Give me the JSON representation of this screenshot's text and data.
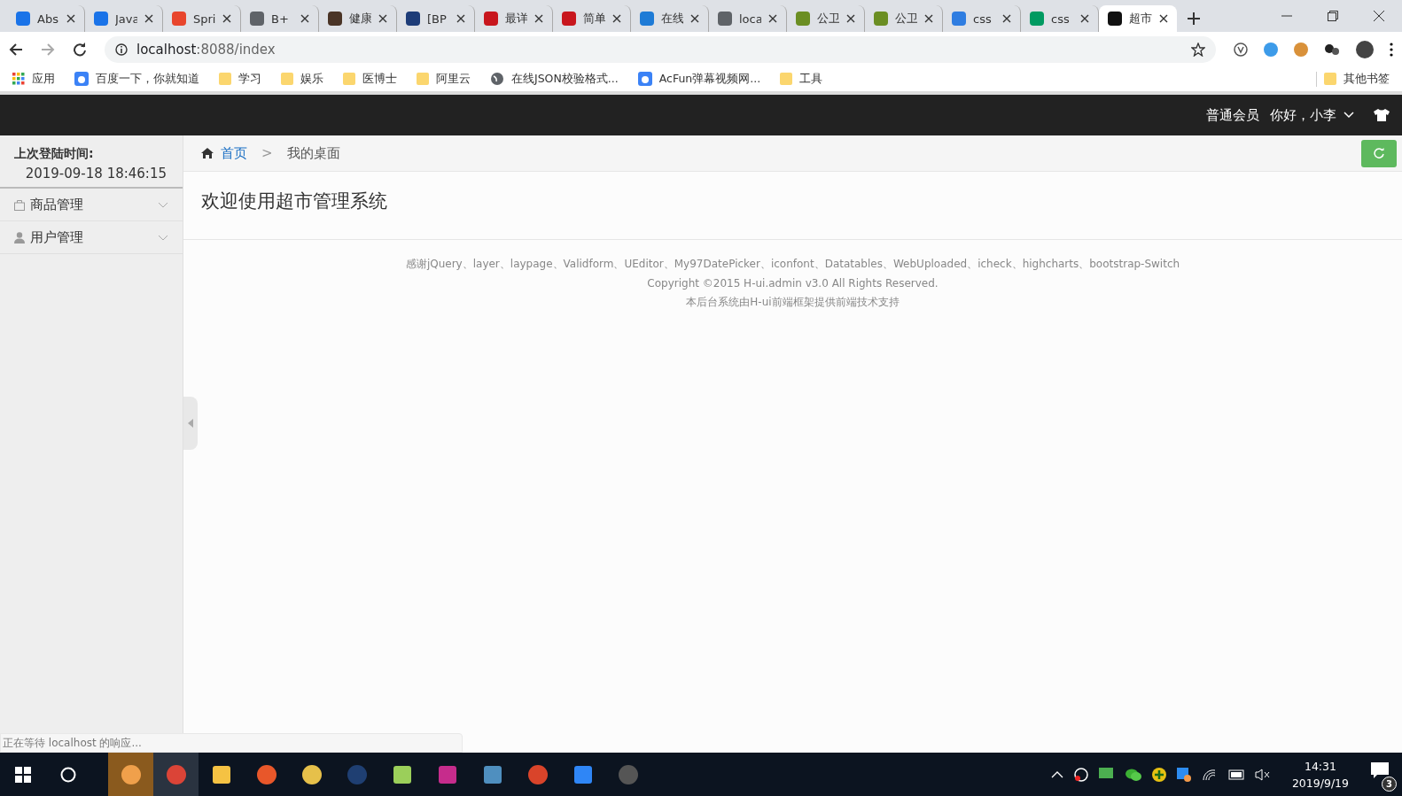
{
  "browser": {
    "tabs": [
      {
        "title": "Abs",
        "color": "#1a73e8",
        "selected": false
      },
      {
        "title": "Java",
        "color": "#1a73e8",
        "selected": false
      },
      {
        "title": "Spri",
        "color": "#e8452c",
        "selected": false
      },
      {
        "title": "B+",
        "color": "#5f6368",
        "selected": false
      },
      {
        "title": "健康",
        "color": "#4a3426",
        "selected": false
      },
      {
        "title": "[BP",
        "color": "#1d3c78",
        "selected": false
      },
      {
        "title": "最详",
        "color": "#c8161d",
        "selected": false
      },
      {
        "title": "简单",
        "color": "#c8161d",
        "selected": false
      },
      {
        "title": "在线",
        "color": "#1e7bd6",
        "selected": false
      },
      {
        "title": "loca",
        "color": "#5f6368",
        "selected": false
      },
      {
        "title": "公卫",
        "color": "#6b8e23",
        "selected": false
      },
      {
        "title": "公卫",
        "color": "#6b8e23",
        "selected": false
      },
      {
        "title": "css",
        "color": "#2f7de1",
        "selected": false
      },
      {
        "title": "css",
        "color": "#009a61",
        "selected": false
      },
      {
        "title": "超市",
        "color": "#111111",
        "selected": true
      }
    ],
    "address": {
      "host": "localhost",
      "path": ":8088/index"
    },
    "bookmarks": [
      {
        "kind": "apps",
        "label": "应用"
      },
      {
        "kind": "site",
        "label": "百度一下，你就知道"
      },
      {
        "kind": "folder",
        "label": "学习"
      },
      {
        "kind": "folder",
        "label": "娱乐"
      },
      {
        "kind": "folder",
        "label": "医博士"
      },
      {
        "kind": "folder",
        "label": "阿里云"
      },
      {
        "kind": "globe",
        "label": "在线JSON校验格式..."
      },
      {
        "kind": "site",
        "label": "AcFun弹幕视频网..."
      },
      {
        "kind": "folder",
        "label": "工具"
      }
    ],
    "other_bookmarks": {
      "label": "其他书签"
    }
  },
  "header": {
    "member": "普通会员",
    "greeting": "你好，小李"
  },
  "sidebar": {
    "login_label": "上次登陆时间:",
    "login_time": "2019-09-18 18:46:15",
    "menu": [
      {
        "kind": "bag",
        "label": "商品管理",
        "expanded": false
      },
      {
        "kind": "user",
        "label": "用户管理",
        "expanded": false
      }
    ]
  },
  "breadcrumb": {
    "items": [
      {
        "kind": "link",
        "label": "首页"
      },
      {
        "kind": "current",
        "label": "我的桌面"
      }
    ],
    "separator": ">"
  },
  "welcome": "欢迎使用超市管理系统",
  "footer": [
    "感谢jQuery、layer、laypage、Validform、UEditor、My97DatePicker、iconfont、Datatables、WebUploaded、icheck、highcharts、bootstrap-Switch",
    "Copyright ©2015 H-ui.admin v3.0 All Rights Reserved.",
    "本后台系统由H-ui前端框架提供前端技术支持"
  ],
  "status": "正在等待 localhost 的响应...",
  "taskbar": {
    "time": "14:31",
    "date": "2019/9/19",
    "notifications": "3"
  }
}
